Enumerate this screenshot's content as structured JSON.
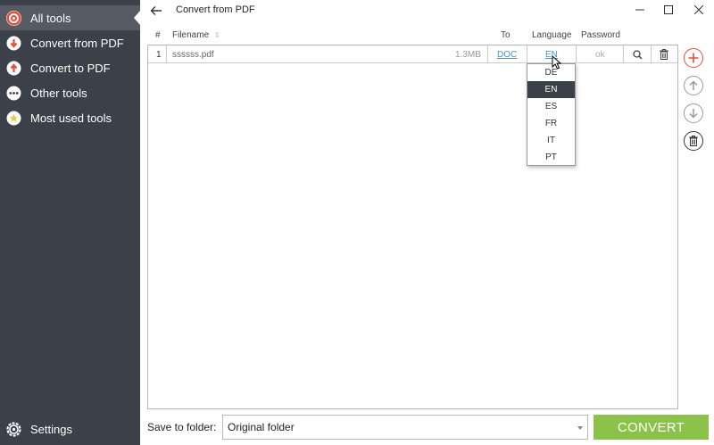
{
  "sidebar": {
    "items": [
      {
        "label": "All tools",
        "icon": "target-icon",
        "color": "#e74c3c"
      },
      {
        "label": "Convert from PDF",
        "icon": "arrow-down-circle-icon",
        "color": "#e74c3c"
      },
      {
        "label": "Convert to PDF",
        "icon": "arrow-up-circle-icon",
        "color": "#e74c3c"
      },
      {
        "label": "Other tools",
        "icon": "more-dots-icon",
        "color": "#ffffff"
      },
      {
        "label": "Most used tools",
        "icon": "star-icon",
        "color": "#f5e26b"
      }
    ],
    "settings_label": "Settings",
    "bg_color": "#3c4048"
  },
  "window": {
    "title": "Convert from PDF"
  },
  "table": {
    "headers": {
      "num": "#",
      "filename": "Filename",
      "to": "To",
      "language": "Language",
      "password": "Password"
    },
    "rows": [
      {
        "num": "1",
        "filename": "ssssss.pdf",
        "size": "1.3MB",
        "to": "DOC",
        "language": "EN",
        "password": "ok"
      }
    ]
  },
  "language_dropdown": {
    "options": [
      "DE",
      "EN",
      "ES",
      "FR",
      "IT",
      "PT"
    ],
    "selected": "EN"
  },
  "footer": {
    "save_label": "Save to folder:",
    "folder_value": "Original folder",
    "convert_label": "CONVERT",
    "convert_color": "#8bc34a"
  }
}
